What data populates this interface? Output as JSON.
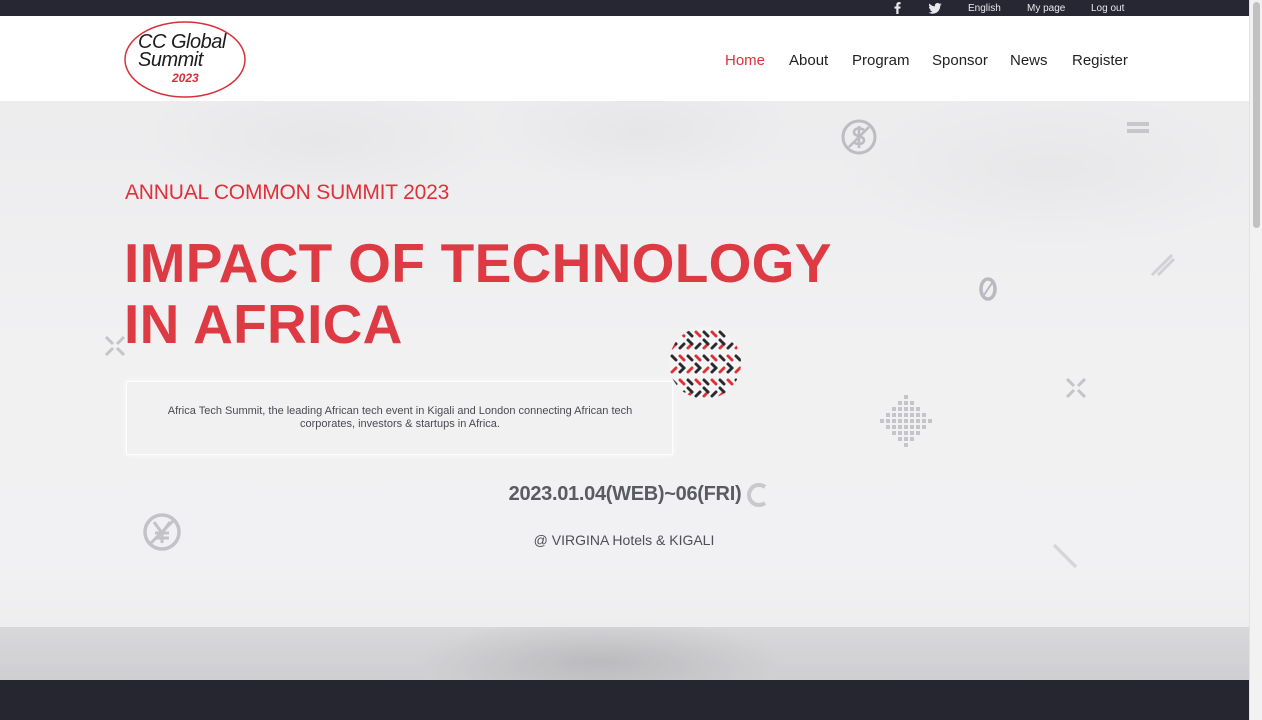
{
  "topbar": {
    "social_icons": [
      "facebook-icon",
      "twitter-icon"
    ],
    "language": "English",
    "my_page": "My page",
    "logout": "Log out"
  },
  "logo": {
    "line1": "CC Global",
    "line2": "Summit",
    "year": "2023"
  },
  "nav": {
    "items": [
      {
        "label": "Home",
        "active": true
      },
      {
        "label": "About",
        "active": false
      },
      {
        "label": "Program",
        "active": false
      },
      {
        "label": "Sponsor",
        "active": false
      },
      {
        "label": "News",
        "active": false
      },
      {
        "label": "Register",
        "active": false
      }
    ]
  },
  "hero": {
    "kicker": "ANNUAL COMMON SUMMIT 2023",
    "headline_line1": "IMPACT OF TECHNOLOGY",
    "headline_line2": "IN AFRICA",
    "description": "Africa Tech Summit, the leading African tech event in Kigali and London connecting African tech corporates, investors & startups in Africa.",
    "date": "2023.01.04(WEB)~06(FRI)",
    "venue": "@ VIRGINA Hotels & KIGALI"
  },
  "decorations": [
    "dollar-icon",
    "equals-icon",
    "zero-glyph",
    "close-x-icon",
    "yen-icon",
    "dot-diamond-icon",
    "patterned-circle"
  ],
  "colors": {
    "accent": "#e0303a",
    "topbar": "#262732",
    "footer": "#25262f"
  }
}
